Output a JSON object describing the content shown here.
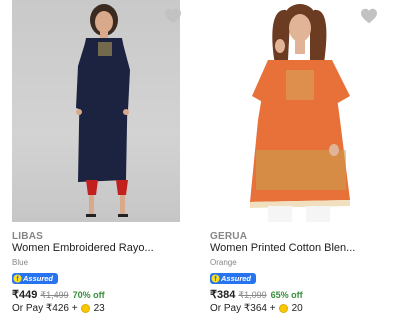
{
  "products": [
    {
      "brand": "LIBAS",
      "title": "Women Embroidered Rayo...",
      "color": "Blue",
      "assured_label": "Assured",
      "price": "₹449",
      "mrp": "₹1,499",
      "discount": "70% off",
      "pay_prefix": "Or Pay ₹426 +",
      "coins": "23"
    },
    {
      "brand": "GERUA",
      "title": "Women Printed Cotton Blen...",
      "color": "Orange",
      "assured_label": "Assured",
      "price": "₹384",
      "mrp": "₹1,099",
      "discount": "65% off",
      "pay_prefix": "Or Pay ₹364 +",
      "coins": "20"
    }
  ],
  "icons": {
    "wishlist": "heart-icon",
    "assured": "flipkart-assured-badge",
    "coin": "supercoin-icon"
  },
  "colors": {
    "discount": "#388e3c",
    "assured": "#2874f0",
    "muted": "#878787"
  }
}
